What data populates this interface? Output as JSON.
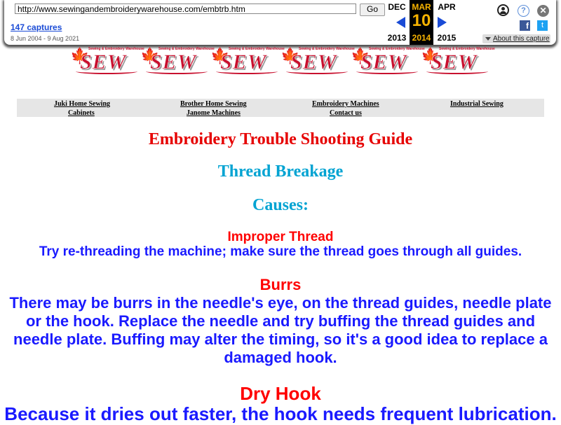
{
  "wayback": {
    "url": "http://www.sewingandembroiderywarehouse.com/embtrb.htm",
    "go_label": "Go",
    "captures_label": "147 captures",
    "date_range": "8 Jun 2004 - 9 Aug 2021",
    "prev_month": "DEC",
    "prev_year": "2013",
    "current_month": "MAR",
    "current_day": "10",
    "current_year": "2014",
    "next_month": "APR",
    "next_year": "2015",
    "help_glyph": "?",
    "close_glyph": "✕",
    "facebook_glyph": "f",
    "twitter_glyph": "t",
    "about_label": "About this capture",
    "accent_color": "#1a4bd6",
    "highlight_color": "#f7b300"
  },
  "banner": {
    "logo_word": "SEW",
    "logo_small": "Sewing & Embroidery Warehouse",
    "leaf_glyph": "🍁",
    "count": 6
  },
  "nav": {
    "juki": "Juki Home Sewing",
    "cabinets": "Cabinets",
    "brother": "Brother Home Sewing",
    "janome": "Janome Machines",
    "embroidery": "Embroidery Machines",
    "contact": "Contact us",
    "industrial": "Industrial Sewing"
  },
  "content": {
    "title": "Embroidery Trouble Shooting Guide",
    "subtitle": "Thread Breakage",
    "causes_label": "Causes:",
    "items": [
      {
        "heading": "Improper Thread",
        "text": "Try re-threading the machine; make sure the thread goes through all guides."
      },
      {
        "heading": "Burrs",
        "text": "There may be burrs in the needle's eye, on the thread guides, needle plate or the hook. Replace the needle and try buffing the thread guides and needle plate. Buffing may alter the timing, so it's a good idea to replace a damaged hook."
      },
      {
        "heading": "Dry Hook",
        "text": "Because it dries out faster, the hook needs frequent lubrication."
      }
    ]
  }
}
